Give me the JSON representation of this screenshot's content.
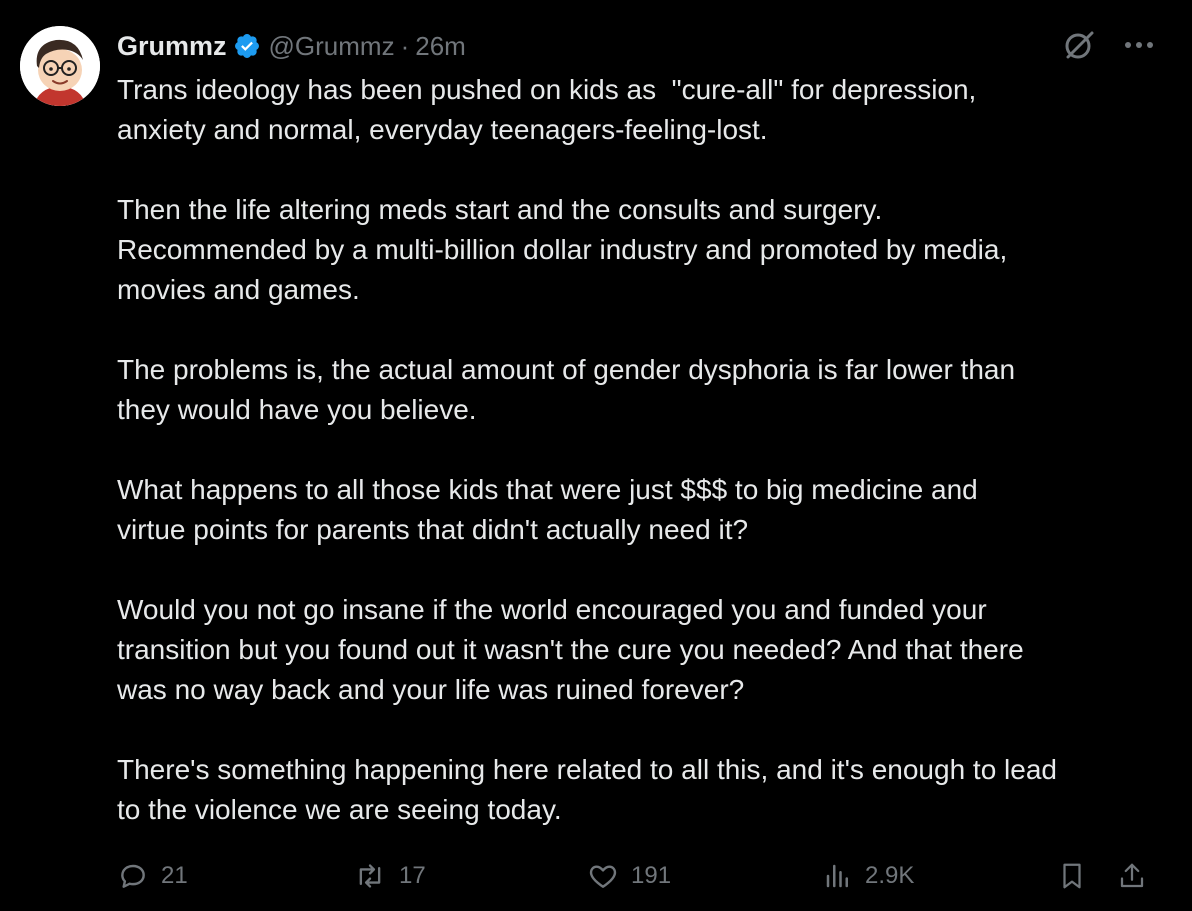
{
  "tweet": {
    "author": {
      "display_name": "Grummz",
      "handle": "@Grummz",
      "verified_icon": "verified-badge-icon"
    },
    "separator": "·",
    "time": "26m",
    "top_actions": {
      "grok_icon": "grok-icon",
      "more_icon": "more-dots-icon"
    },
    "paragraphs": [
      "Trans ideology has been pushed on kids as  \"cure-all\" for depression,\nanxiety and normal, everyday teenagers-feeling-lost.",
      "Then the life altering meds start and the consults and surgery.\nRecommended by a multi-billion dollar industry and promoted by media,\nmovies and games.",
      "The problems is, the actual amount of gender dysphoria is far lower than\nthey would have you believe.",
      "What happens to all those kids that were just $$$ to big medicine and\nvirtue points for parents that didn't actually need it?",
      "Would you not go insane if the world encouraged you and funded your\ntransition but you found out it wasn't the cure you needed? And that there\nwas no way back and your life was ruined forever?",
      "There's something happening here related to all this, and it's enough to lead\nto the violence we are seeing today."
    ],
    "actions": {
      "replies": "21",
      "reposts": "17",
      "likes": "191",
      "views": "2.9K"
    },
    "colors": {
      "background": "#000000",
      "text": "#e7e9ea",
      "muted": "#71767b",
      "verified": "#1d9bf0"
    }
  }
}
